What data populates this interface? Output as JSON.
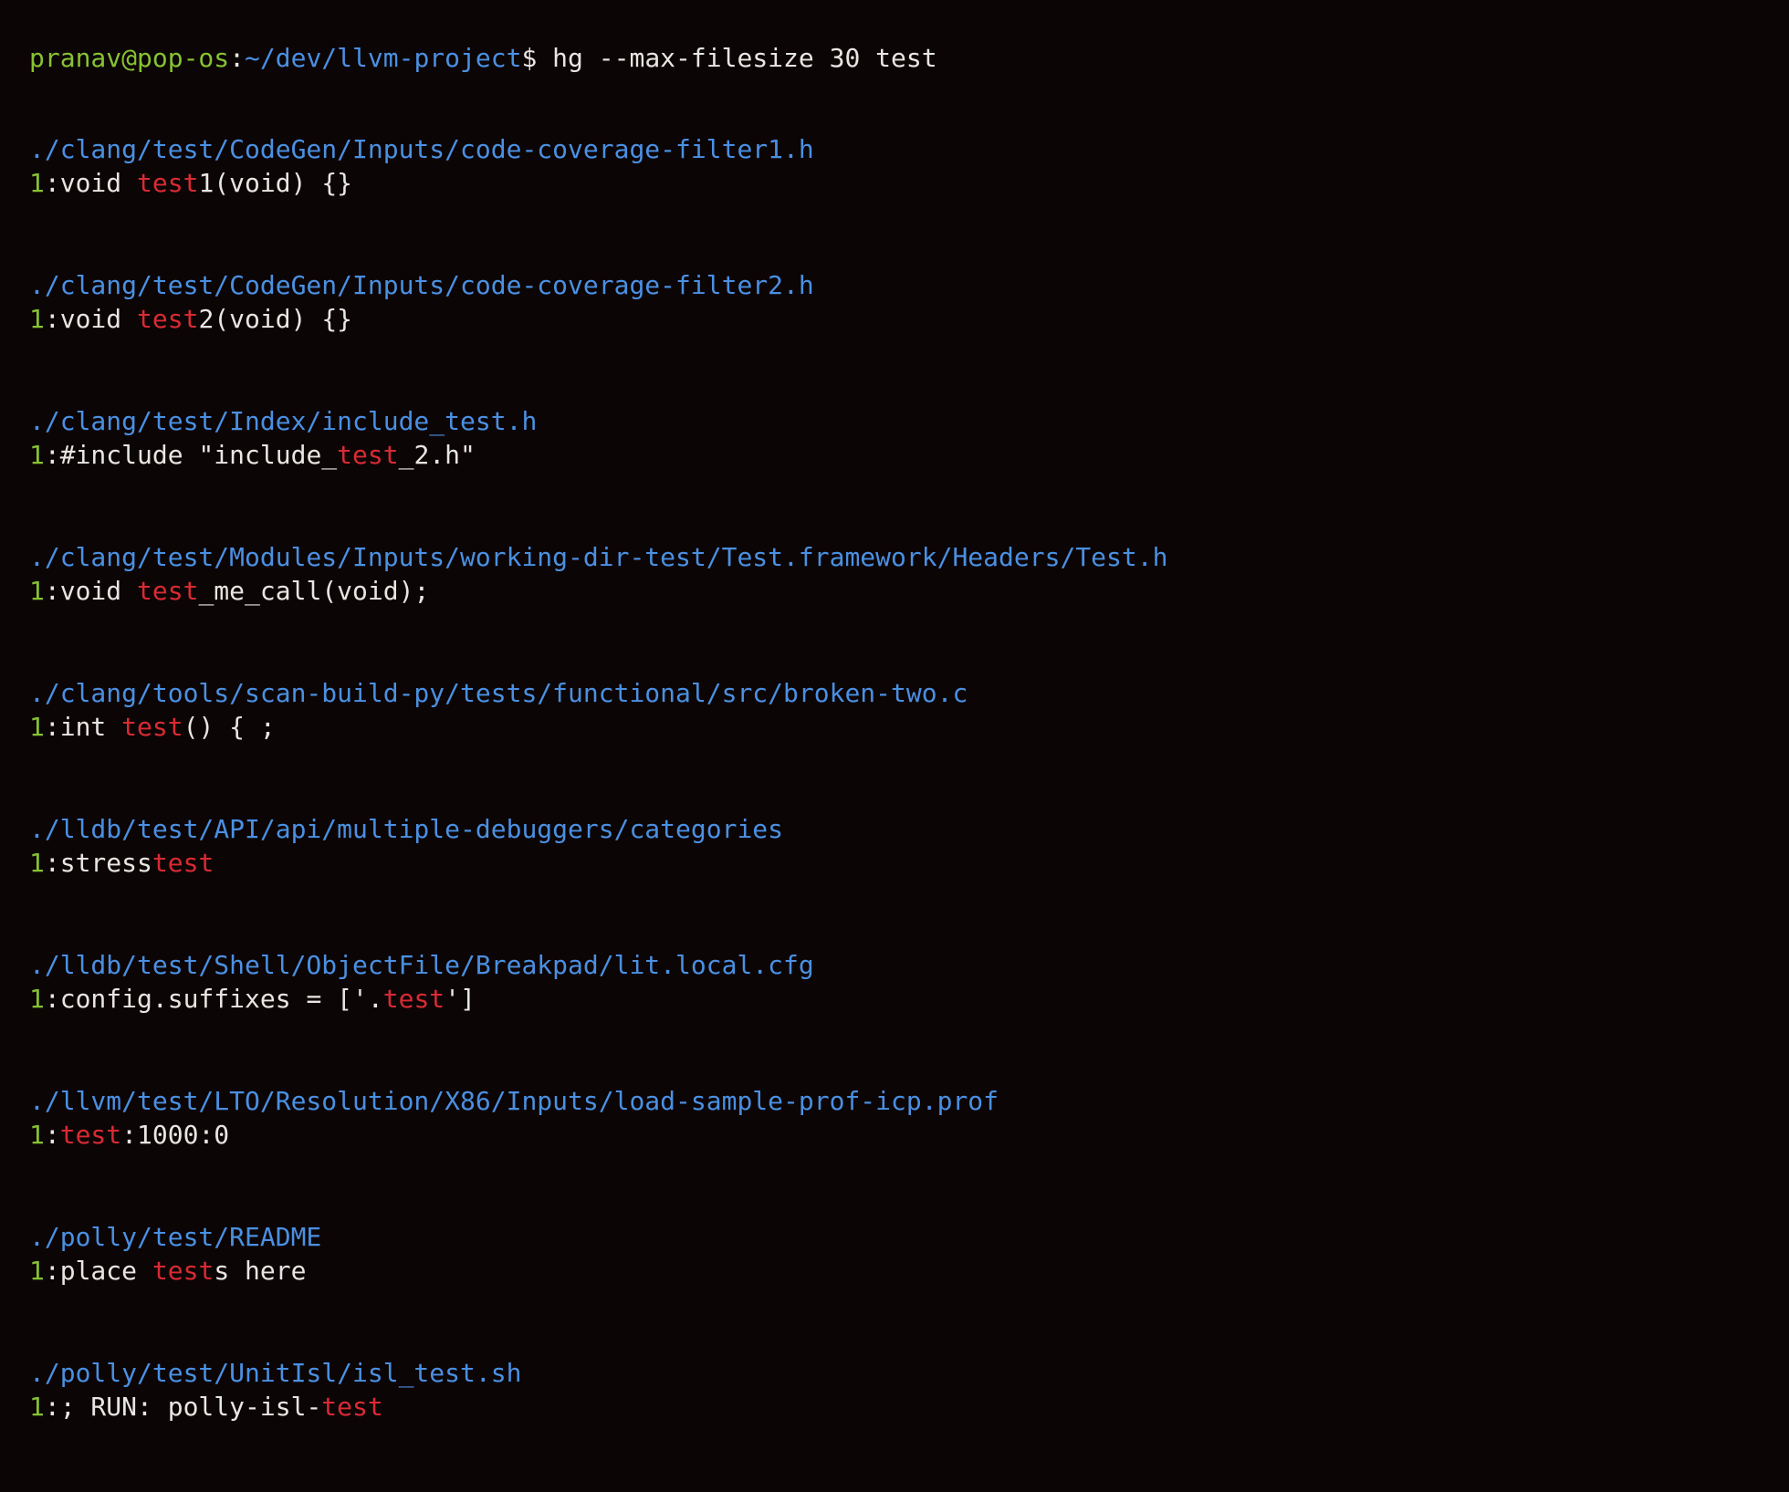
{
  "prompt": {
    "user_host": "pranav@pop-os",
    "separator": ":",
    "cwd": "~/dev/llvm-project",
    "symbol": "$",
    "command": " hg --max-filesize 30 test"
  },
  "results": [
    {
      "path": "./clang/test/CodeGen/Inputs/code-coverage-filter1.h",
      "line_number": "1",
      "colon": ":",
      "before": "void ",
      "match": "test",
      "after": "1(void) {}"
    },
    {
      "path": "./clang/test/CodeGen/Inputs/code-coverage-filter2.h",
      "line_number": "1",
      "colon": ":",
      "before": "void ",
      "match": "test",
      "after": "2(void) {}"
    },
    {
      "path": "./clang/test/Index/include_test.h",
      "line_number": "1",
      "colon": ":",
      "before": "#include \"include_",
      "match": "test",
      "after": "_2.h\""
    },
    {
      "path": "./clang/test/Modules/Inputs/working-dir-test/Test.framework/Headers/Test.h",
      "line_number": "1",
      "colon": ":",
      "before": "void ",
      "match": "test",
      "after": "_me_call(void);"
    },
    {
      "path": "./clang/tools/scan-build-py/tests/functional/src/broken-two.c",
      "line_number": "1",
      "colon": ":",
      "before": "int ",
      "match": "test",
      "after": "() { ;"
    },
    {
      "path": "./lldb/test/API/api/multiple-debuggers/categories",
      "line_number": "1",
      "colon": ":",
      "before": "stress",
      "match": "test",
      "after": ""
    },
    {
      "path": "./lldb/test/Shell/ObjectFile/Breakpad/lit.local.cfg",
      "line_number": "1",
      "colon": ":",
      "before": "config.suffixes = ['.",
      "match": "test",
      "after": "']"
    },
    {
      "path": "./llvm/test/LTO/Resolution/X86/Inputs/load-sample-prof-icp.prof",
      "line_number": "1",
      "colon": ":",
      "before": "",
      "match": "test",
      "after": ":1000:0"
    },
    {
      "path": "./polly/test/README",
      "line_number": "1",
      "colon": ":",
      "before": "place ",
      "match": "test",
      "after": "s here"
    },
    {
      "path": "./polly/test/UnitIsl/isl_test.sh",
      "line_number": "1",
      "colon": ":",
      "before": "; RUN: polly-isl-",
      "match": "test",
      "after": ""
    }
  ],
  "colors": {
    "background": "#0c0505",
    "path": "#4a90e2",
    "user_host": "#86c232",
    "line_number": "#86c232",
    "match": "#d92a34",
    "text": "#e8e6e3"
  }
}
